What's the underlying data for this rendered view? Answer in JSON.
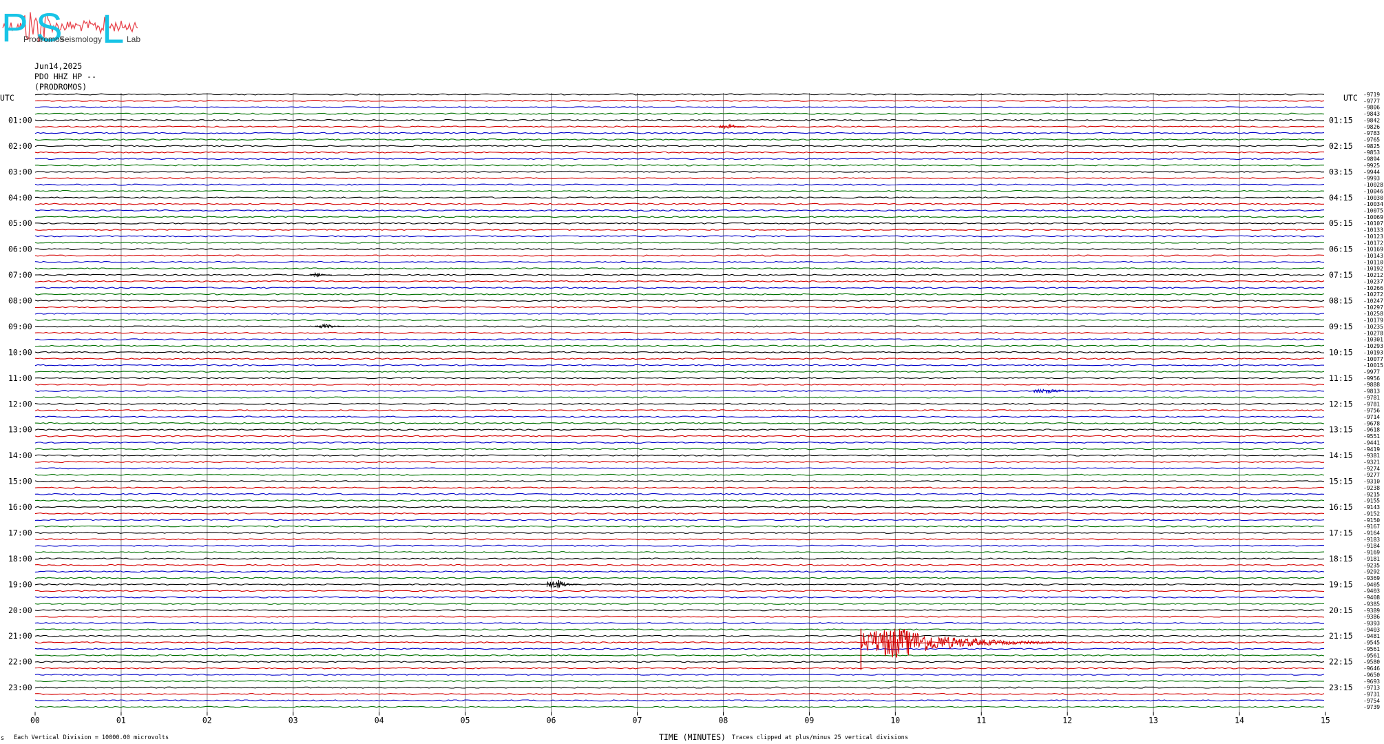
{
  "logo": {
    "letters": [
      "P",
      "S",
      "L"
    ],
    "words": [
      "Prodromos",
      "Seismology",
      "Lab"
    ],
    "waveform_color": "#e8474f",
    "letter_color": "#18c4e6"
  },
  "header": {
    "date": "Jun14,2025",
    "station": "PDO HHZ HP --",
    "location": "(PRODROMOS)"
  },
  "axis": {
    "left_title": "UTC",
    "right_title": "UTC",
    "x_title": "TIME (MINUTES)",
    "footer_left": "Each Vertical Division = 10000.00 microvolts",
    "footer_right": "Traces clipped at plus/minus 25 vertical divisions",
    "corner_mark": "s"
  },
  "chart_data": {
    "type": "helicorder",
    "xlabel": "TIME (MINUTES)",
    "xlim": [
      0,
      15
    ],
    "x_ticks": [
      "00",
      "01",
      "02",
      "03",
      "04",
      "05",
      "06",
      "07",
      "08",
      "09",
      "10",
      "11",
      "12",
      "13",
      "14",
      "15"
    ],
    "rows": 96,
    "minutes_per_row": 15,
    "trace_colors": [
      "#000000",
      "#d40000",
      "#0000c8",
      "#007000"
    ],
    "left_hour_labels": [
      "01:00",
      "02:00",
      "03:00",
      "04:00",
      "05:00",
      "06:00",
      "07:00",
      "08:00",
      "09:00",
      "10:00",
      "11:00",
      "12:00",
      "13:00",
      "14:00",
      "15:00",
      "16:00",
      "17:00",
      "18:00",
      "19:00",
      "20:00",
      "21:00",
      "22:00",
      "23:00"
    ],
    "right_hour_labels": [
      "01:15",
      "02:15",
      "03:15",
      "04:15",
      "05:15",
      "06:15",
      "07:15",
      "08:15",
      "09:15",
      "10:15",
      "11:15",
      "12:15",
      "13:15",
      "14:15",
      "15:15",
      "16:15",
      "17:15",
      "18:15",
      "19:15",
      "20:15",
      "21:15",
      "22:15",
      "23:15"
    ],
    "row_means": [
      "-9719",
      "-9777",
      "-9806",
      "-9843",
      "-9842",
      "-9826",
      "-9783",
      "-9765",
      "-9825",
      "-9853",
      "-9894",
      "-9925",
      "-9944",
      "-9993",
      "-10028",
      "-10046",
      "-10030",
      "-10034",
      "-10075",
      "-10069",
      "-10107",
      "-10133",
      "-10123",
      "-10172",
      "-10169",
      "-10143",
      "-10110",
      "-10192",
      "-10212",
      "-10237",
      "-10266",
      "-10272",
      "-10247",
      "-10297",
      "-10258",
      "-10179",
      "-10235",
      "-10278",
      "-10301",
      "-10293",
      "-10193",
      "-10077",
      "-10015",
      "-9977",
      "-9956",
      "-9888",
      "-9813",
      "-9781",
      "-9781",
      "-9756",
      "-9714",
      "-9678",
      "-9618",
      "-9551",
      "-9441",
      "-9419",
      "-9381",
      "-9321",
      "-9274",
      "-9277",
      "-9310",
      "-9238",
      "-9215",
      "-9155",
      "-9143",
      "-9152",
      "-9150",
      "-9167",
      "-9164",
      "-9183",
      "-9184",
      "-9169",
      "-9181",
      "-9235",
      "-9292",
      "-9369",
      "-9405",
      "-9403",
      "-9408",
      "-9385",
      "-9389",
      "-9386",
      "-9393",
      "-9403",
      "-9481",
      "-9545",
      "-9561",
      "-9561",
      "-9580",
      "-9646",
      "-9650",
      "-9693",
      "-9713",
      "-9731",
      "-9754",
      "-9739"
    ],
    "events": [
      {
        "label": "earthquake",
        "row": 85,
        "start_min": 9.6,
        "peak_min": 10.0,
        "end_min": 12.0,
        "amplitude": "clipped"
      },
      {
        "label": "event",
        "row": 76,
        "start_min": 5.95,
        "peak_min": 6.1,
        "end_min": 6.35,
        "amplitude": "moderate"
      },
      {
        "label": "event",
        "row": 28,
        "start_min": 3.2,
        "peak_min": 3.3,
        "end_min": 3.45,
        "amplitude": "small"
      },
      {
        "label": "event",
        "row": 36,
        "start_min": 3.25,
        "peak_min": 3.4,
        "end_min": 3.6,
        "amplitude": "small"
      },
      {
        "label": "event",
        "row": 5,
        "start_min": 7.95,
        "peak_min": 8.1,
        "end_min": 8.25,
        "amplitude": "small"
      },
      {
        "label": "event",
        "row": 46,
        "start_min": 11.6,
        "peak_min": 11.8,
        "end_min": 12.3,
        "amplitude": "small"
      }
    ]
  }
}
